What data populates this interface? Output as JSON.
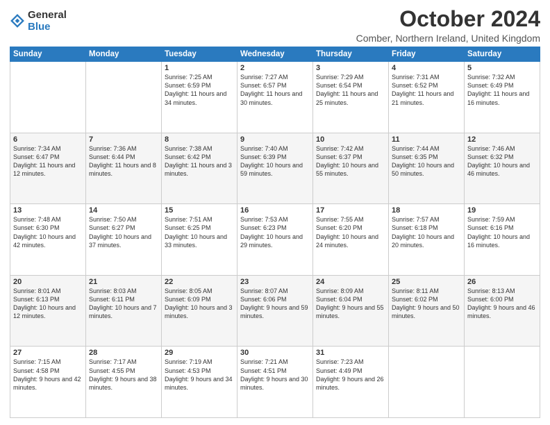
{
  "logo": {
    "general": "General",
    "blue": "Blue"
  },
  "header": {
    "month": "October 2024",
    "location": "Comber, Northern Ireland, United Kingdom"
  },
  "days": [
    "Sunday",
    "Monday",
    "Tuesday",
    "Wednesday",
    "Thursday",
    "Friday",
    "Saturday"
  ],
  "weeks": [
    [
      {
        "day": "",
        "content": ""
      },
      {
        "day": "",
        "content": ""
      },
      {
        "day": "1",
        "content": "Sunrise: 7:25 AM\nSunset: 6:59 PM\nDaylight: 11 hours\nand 34 minutes."
      },
      {
        "day": "2",
        "content": "Sunrise: 7:27 AM\nSunset: 6:57 PM\nDaylight: 11 hours\nand 30 minutes."
      },
      {
        "day": "3",
        "content": "Sunrise: 7:29 AM\nSunset: 6:54 PM\nDaylight: 11 hours\nand 25 minutes."
      },
      {
        "day": "4",
        "content": "Sunrise: 7:31 AM\nSunset: 6:52 PM\nDaylight: 11 hours\nand 21 minutes."
      },
      {
        "day": "5",
        "content": "Sunrise: 7:32 AM\nSunset: 6:49 PM\nDaylight: 11 hours\nand 16 minutes."
      }
    ],
    [
      {
        "day": "6",
        "content": "Sunrise: 7:34 AM\nSunset: 6:47 PM\nDaylight: 11 hours\nand 12 minutes."
      },
      {
        "day": "7",
        "content": "Sunrise: 7:36 AM\nSunset: 6:44 PM\nDaylight: 11 hours\nand 8 minutes."
      },
      {
        "day": "8",
        "content": "Sunrise: 7:38 AM\nSunset: 6:42 PM\nDaylight: 11 hours\nand 3 minutes."
      },
      {
        "day": "9",
        "content": "Sunrise: 7:40 AM\nSunset: 6:39 PM\nDaylight: 10 hours\nand 59 minutes."
      },
      {
        "day": "10",
        "content": "Sunrise: 7:42 AM\nSunset: 6:37 PM\nDaylight: 10 hours\nand 55 minutes."
      },
      {
        "day": "11",
        "content": "Sunrise: 7:44 AM\nSunset: 6:35 PM\nDaylight: 10 hours\nand 50 minutes."
      },
      {
        "day": "12",
        "content": "Sunrise: 7:46 AM\nSunset: 6:32 PM\nDaylight: 10 hours\nand 46 minutes."
      }
    ],
    [
      {
        "day": "13",
        "content": "Sunrise: 7:48 AM\nSunset: 6:30 PM\nDaylight: 10 hours\nand 42 minutes."
      },
      {
        "day": "14",
        "content": "Sunrise: 7:50 AM\nSunset: 6:27 PM\nDaylight: 10 hours\nand 37 minutes."
      },
      {
        "day": "15",
        "content": "Sunrise: 7:51 AM\nSunset: 6:25 PM\nDaylight: 10 hours\nand 33 minutes."
      },
      {
        "day": "16",
        "content": "Sunrise: 7:53 AM\nSunset: 6:23 PM\nDaylight: 10 hours\nand 29 minutes."
      },
      {
        "day": "17",
        "content": "Sunrise: 7:55 AM\nSunset: 6:20 PM\nDaylight: 10 hours\nand 24 minutes."
      },
      {
        "day": "18",
        "content": "Sunrise: 7:57 AM\nSunset: 6:18 PM\nDaylight: 10 hours\nand 20 minutes."
      },
      {
        "day": "19",
        "content": "Sunrise: 7:59 AM\nSunset: 6:16 PM\nDaylight: 10 hours\nand 16 minutes."
      }
    ],
    [
      {
        "day": "20",
        "content": "Sunrise: 8:01 AM\nSunset: 6:13 PM\nDaylight: 10 hours\nand 12 minutes."
      },
      {
        "day": "21",
        "content": "Sunrise: 8:03 AM\nSunset: 6:11 PM\nDaylight: 10 hours\nand 7 minutes."
      },
      {
        "day": "22",
        "content": "Sunrise: 8:05 AM\nSunset: 6:09 PM\nDaylight: 10 hours\nand 3 minutes."
      },
      {
        "day": "23",
        "content": "Sunrise: 8:07 AM\nSunset: 6:06 PM\nDaylight: 9 hours\nand 59 minutes."
      },
      {
        "day": "24",
        "content": "Sunrise: 8:09 AM\nSunset: 6:04 PM\nDaylight: 9 hours\nand 55 minutes."
      },
      {
        "day": "25",
        "content": "Sunrise: 8:11 AM\nSunset: 6:02 PM\nDaylight: 9 hours\nand 50 minutes."
      },
      {
        "day": "26",
        "content": "Sunrise: 8:13 AM\nSunset: 6:00 PM\nDaylight: 9 hours\nand 46 minutes."
      }
    ],
    [
      {
        "day": "27",
        "content": "Sunrise: 7:15 AM\nSunset: 4:58 PM\nDaylight: 9 hours\nand 42 minutes."
      },
      {
        "day": "28",
        "content": "Sunrise: 7:17 AM\nSunset: 4:55 PM\nDaylight: 9 hours\nand 38 minutes."
      },
      {
        "day": "29",
        "content": "Sunrise: 7:19 AM\nSunset: 4:53 PM\nDaylight: 9 hours\nand 34 minutes."
      },
      {
        "day": "30",
        "content": "Sunrise: 7:21 AM\nSunset: 4:51 PM\nDaylight: 9 hours\nand 30 minutes."
      },
      {
        "day": "31",
        "content": "Sunrise: 7:23 AM\nSunset: 4:49 PM\nDaylight: 9 hours\nand 26 minutes."
      },
      {
        "day": "",
        "content": ""
      },
      {
        "day": "",
        "content": ""
      }
    ]
  ]
}
